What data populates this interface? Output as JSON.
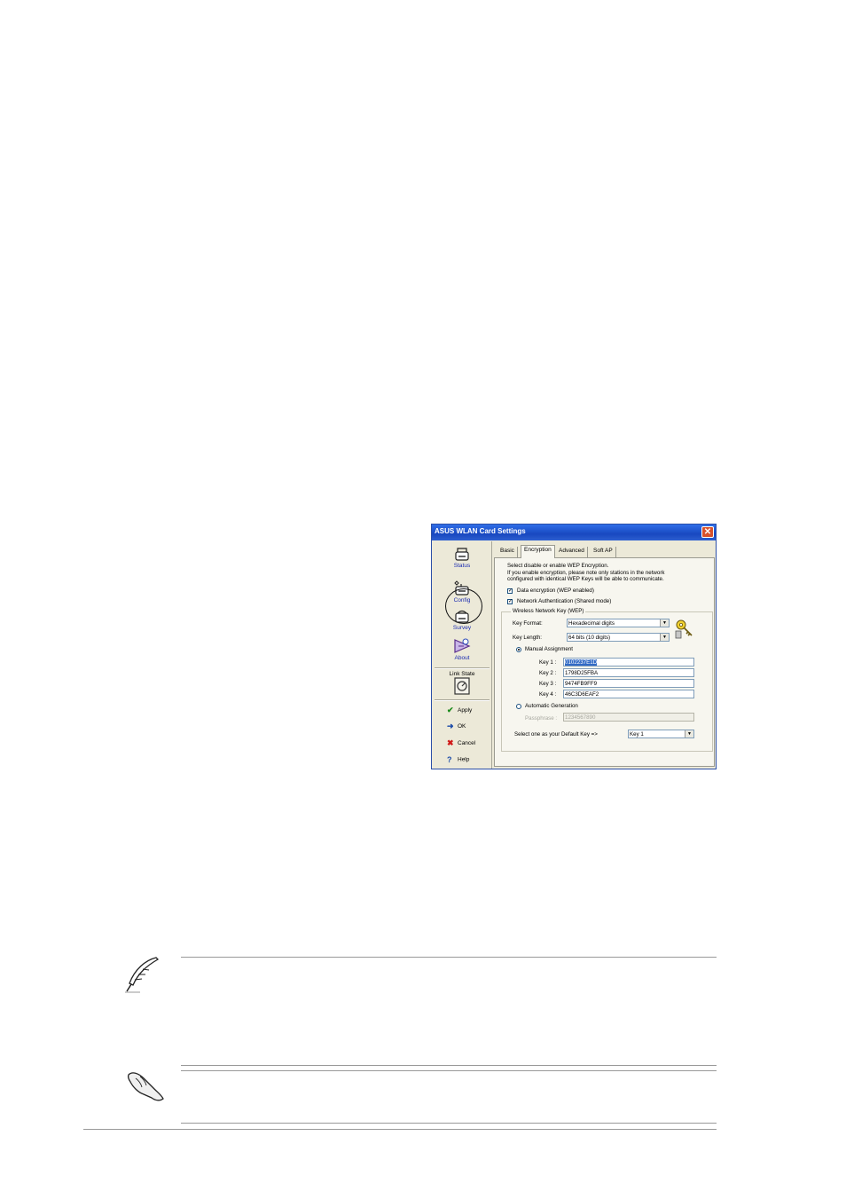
{
  "dialog": {
    "title": "ASUS WLAN Card Settings",
    "close_label": "✕",
    "nav": {
      "status": "Status",
      "config": "Config",
      "survey": "Survey",
      "about": "About",
      "link_state": "Link State"
    },
    "actions": {
      "apply": "Apply",
      "ok": "OK",
      "cancel": "Cancel",
      "help": "Help"
    },
    "tabs": [
      "Basic",
      "Encryption",
      "Advanced",
      "Soft AP"
    ],
    "active_tab": "Encryption",
    "encryption": {
      "intro_line1": "Select disable or enable WEP Encryption.",
      "intro_line2": "If you enable encryption, please note only stations in the network",
      "intro_line3": "configured with identical WEP Keys will be able to communicate.",
      "data_encryption_label": "Data encryption (WEP enabled)",
      "data_encryption_checked": true,
      "network_auth_label": "Network Authentication (Shared mode)",
      "network_auth_checked": true,
      "group_title": "Wireless Network Key (WEP)",
      "key_format_label": "Key Format:",
      "key_format_value": "Hexadecimal digits",
      "key_length_label": "Key Length:",
      "key_length_value": "64 bits (10 digits)",
      "manual_label": "Manual Assignment",
      "manual_selected": true,
      "keys": [
        {
          "label": "Key 1 :",
          "value": "0102237E1D"
        },
        {
          "label": "Key 2 :",
          "value": "1798D25FBA"
        },
        {
          "label": "Key 3 :",
          "value": "9474FB9FF9"
        },
        {
          "label": "Key 4 :",
          "value": "46C3D6EAF2"
        }
      ],
      "automatic_label": "Automatic Generation",
      "automatic_selected": false,
      "passphrase_label": "Passphrase :",
      "passphrase_value": "1234567890",
      "default_key_label": "Select one as your Default Key =>",
      "default_key_value": "Key 1"
    }
  },
  "icons": {
    "note": "feather-pen-icon",
    "caution": "pointing-hand-icon",
    "key": "keys-icon"
  }
}
